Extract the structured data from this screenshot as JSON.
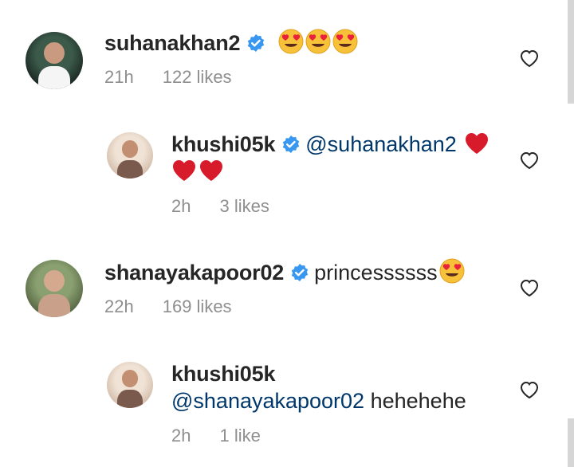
{
  "comments": [
    {
      "username": "suhanakhan2",
      "verified": true,
      "emojis": [
        "heart-eyes",
        "heart-eyes",
        "heart-eyes"
      ],
      "time": "21h",
      "likes": "122 likes"
    },
    {
      "username": "khushi05k",
      "verified": true,
      "mention": "@suhanakhan2",
      "emojis": [
        "red-heart",
        "red-heart",
        "red-heart"
      ],
      "time": "2h",
      "likes": "3 likes"
    },
    {
      "username": "shanayakapoor02",
      "verified": true,
      "text": "princessssss",
      "emojis": [
        "heart-eyes"
      ],
      "time": "22h",
      "likes": "169 likes"
    },
    {
      "username": "khushi05k",
      "verified": false,
      "mention": "@shanayakapoor02",
      "text": "hehehehe",
      "time": "2h",
      "likes": "1 like"
    }
  ],
  "colors": {
    "verified_badge": "#3897f0",
    "mention": "#00376b",
    "meta_text": "#8e8e8e",
    "heart": "#d81b2b"
  }
}
